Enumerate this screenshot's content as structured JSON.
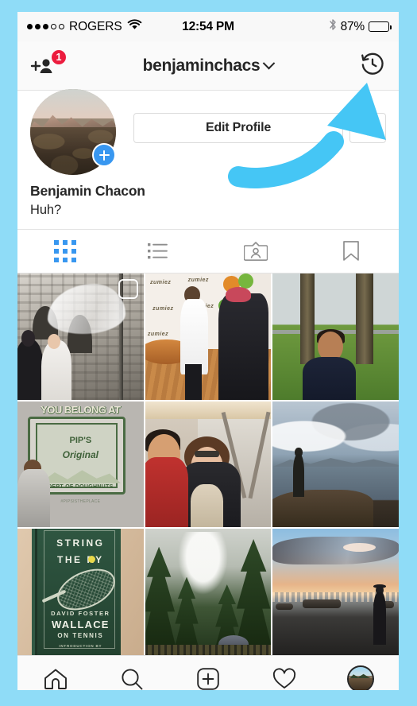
{
  "meta": {
    "app": "Instagram",
    "screen": "Profile",
    "accent_blue": "#3897f0",
    "badge_red": "#ec1c3e",
    "annotation_color": "#45c6f5",
    "page_background": "#8fdcf7"
  },
  "status_bar": {
    "signal_dots_filled": 3,
    "signal_dots_total": 5,
    "carrier": "ROGERS",
    "wifi_icon": "wifi-icon",
    "time": "12:54 PM",
    "bluetooth_icon": "bluetooth-icon",
    "battery_percent": "87%",
    "battery_level": 87
  },
  "nav_bar": {
    "add_person_icon": "add-person-icon",
    "notification_badge": "1",
    "title": "benjaminchacs",
    "chevron_icon": "chevron-down-icon",
    "archive_icon": "history-clock-icon"
  },
  "profile": {
    "avatar_icon": "profile-avatar",
    "story_add_icon": "add-story-plus-icon",
    "edit_profile_label": "Edit Profile",
    "settings_icon": "gear-icon",
    "full_name": "Benjamin Chacon",
    "bio": "Huh?"
  },
  "tabs": [
    {
      "name": "grid",
      "icon": "grid-icon",
      "active": true
    },
    {
      "name": "list",
      "icon": "list-icon",
      "active": false
    },
    {
      "name": "tagged",
      "icon": "photos-of-you-icon",
      "active": false
    },
    {
      "name": "saved",
      "icon": "bookmark-icon",
      "active": false
    }
  ],
  "grid": {
    "posts": [
      {
        "id": "post-1",
        "art": "art-wedding",
        "alt": "Wedding couple outside stone church with flowing veil",
        "multi_post": true
      },
      {
        "id": "post-2",
        "art": "art-zumiez",
        "alt": "Zumiez event backdrop, person in white shirt greeting guest, balloons",
        "multi_post": false
      },
      {
        "id": "post-3",
        "art": "art-portrait",
        "alt": "Smiling man in navy shirt in a park with trees",
        "multi_post": false
      },
      {
        "id": "post-4",
        "art": "art-pips",
        "alt": "Mural reading YOU BELONG AT PIP'S Original Dept of Doughnuts",
        "multi_post": false
      },
      {
        "id": "post-5",
        "art": "art-couple",
        "alt": "Man in red sweater kissing woman's cheek by a food truck",
        "multi_post": false
      },
      {
        "id": "post-6",
        "art": "art-shore",
        "alt": "Person standing on rocky shore looking at cloudy water",
        "multi_post": false
      },
      {
        "id": "post-7",
        "art": "art-book",
        "alt": "String Theory book cover by David Foster Wallace",
        "multi_post": false
      },
      {
        "id": "post-8",
        "art": "art-forest",
        "alt": "Misty forest with person holding an umbrella",
        "multi_post": false
      },
      {
        "id": "post-9",
        "art": "art-beach",
        "alt": "Beach at sunset with person walking past driftwood logs",
        "multi_post": false
      }
    ],
    "post_4_text": {
      "line1": "YOU BELONG AT",
      "line2": "PIP'S",
      "line3": "Original",
      "line4": "DEPT OF DOUGHNUTS",
      "line5": "#PIPSISTHEPLACE"
    },
    "post_7_text": {
      "title_line1": "STRING",
      "title_line2": "THE RY",
      "author_first": "DAVID FOSTER",
      "author_last": "WALLACE",
      "subtitle": "ON TENNIS",
      "intro": "INTRODUCTION BY"
    },
    "post_2_text": {
      "brand": "zumiez"
    }
  },
  "bottom_bar": [
    {
      "name": "home",
      "icon": "home-icon"
    },
    {
      "name": "search",
      "icon": "search-icon"
    },
    {
      "name": "add-post",
      "icon": "plus-square-icon"
    },
    {
      "name": "activity",
      "icon": "heart-icon"
    },
    {
      "name": "profile",
      "icon": "profile-avatar-icon"
    }
  ],
  "annotation": {
    "type": "curved-arrow",
    "points_to": "history-clock-icon",
    "color": "#45c6f5"
  }
}
